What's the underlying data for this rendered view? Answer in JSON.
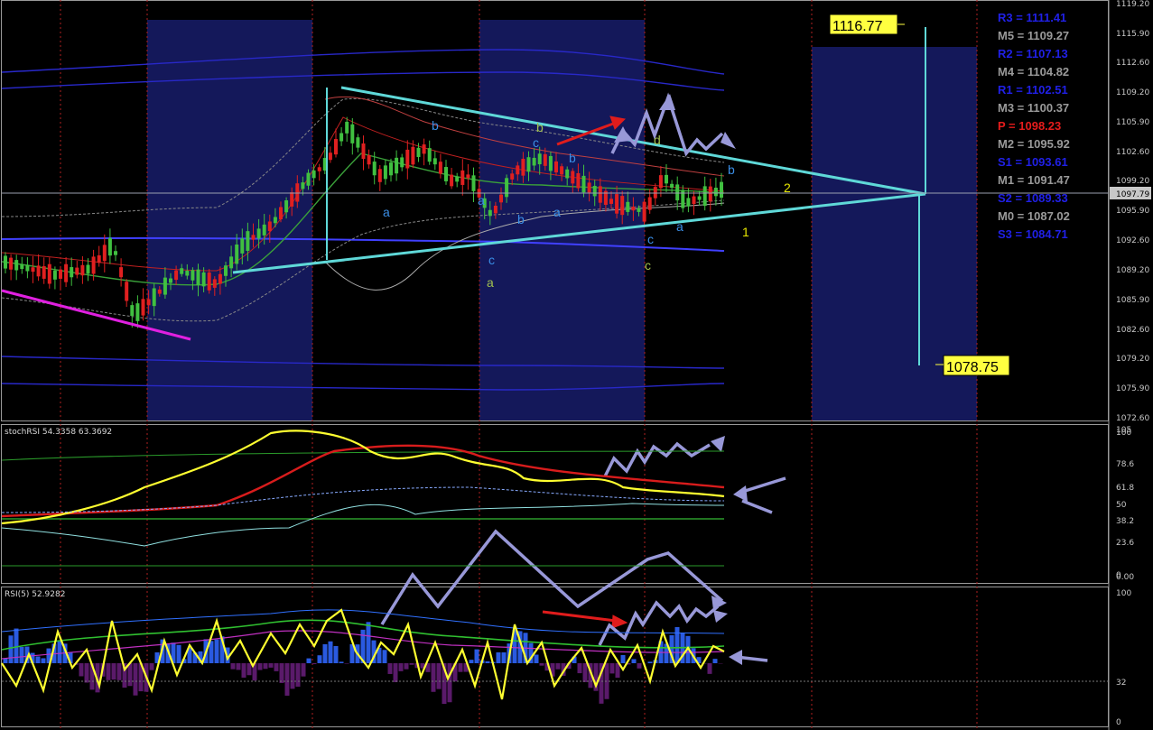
{
  "chart_data": [
    {
      "type": "candlestick",
      "panel": "price",
      "ylim": [
        1072.6,
        1119.2
      ],
      "y_ticks": [
        "1119.20",
        "1115.90",
        "1112.60",
        "1109.20",
        "1105.90",
        "1102.60",
        "1099.20",
        "1095.90",
        "1092.60",
        "1089.20",
        "1085.90",
        "1082.60",
        "1079.20",
        "1075.90",
        "1072.60"
      ],
      "current_price": "1097.79",
      "target_high": "1116.77",
      "target_low": "1078.75",
      "pivot_levels": [
        {
          "label": "R3 = 1111.41",
          "value": 1111.41,
          "color": "#2020e6"
        },
        {
          "label": "M5 = 1109.27",
          "value": 1109.27,
          "color": "#9a9a9a"
        },
        {
          "label": "R2 = 1107.13",
          "value": 1107.13,
          "color": "#2020e6"
        },
        {
          "label": "M4 = 1104.82",
          "value": 1104.82,
          "color": "#9a9a9a"
        },
        {
          "label": "R1 = 1102.51",
          "value": 1102.51,
          "color": "#2020e6"
        },
        {
          "label": "M3 = 1100.37",
          "value": 1100.37,
          "color": "#9a9a9a"
        },
        {
          "label": "P  = 1098.23",
          "value": 1098.23,
          "color": "#e61c1c"
        },
        {
          "label": "M2 = 1095.92",
          "value": 1095.92,
          "color": "#9a9a9a"
        },
        {
          "label": "S1 = 1093.61",
          "value": 1093.61,
          "color": "#2020e6"
        },
        {
          "label": "M1 = 1091.47",
          "value": 1091.47,
          "color": "#9a9a9a"
        },
        {
          "label": "S2 = 1089.33",
          "value": 1089.33,
          "color": "#2020e6"
        },
        {
          "label": "M0 = 1087.02",
          "value": 1087.02,
          "color": "#9a9a9a"
        },
        {
          "label": "S3 = 1084.71",
          "value": 1084.71,
          "color": "#2020e6"
        }
      ],
      "wave_labels": [
        {
          "text": "b",
          "color": "#a0c050"
        },
        {
          "text": "c",
          "color": "#3a8ee6"
        },
        {
          "text": "d",
          "color": "#a0c050"
        },
        {
          "text": "b",
          "color": "#3a8ee6"
        },
        {
          "text": "b",
          "color": "#3a8ee6"
        },
        {
          "text": "b",
          "color": "#3a8ee6"
        },
        {
          "text": "a",
          "color": "#3a8ee6"
        },
        {
          "text": "a",
          "color": "#3a8ee6"
        },
        {
          "text": "a",
          "color": "#3a8ee6"
        },
        {
          "text": "a",
          "color": "#3a8ee6"
        },
        {
          "text": "c",
          "color": "#3a8ee6"
        },
        {
          "text": "b",
          "color": "#3a8ee6"
        },
        {
          "text": "c",
          "color": "#3a8ee6"
        },
        {
          "text": "a",
          "color": "#a0c050"
        },
        {
          "text": "c",
          "color": "#a0c050"
        },
        {
          "text": "2",
          "color": "#e6e600"
        },
        {
          "text": "1",
          "color": "#e6e600"
        }
      ]
    },
    {
      "type": "line",
      "panel": "stochRSI",
      "title": "stochRSI 54.3358 63.3692",
      "y_ticks": [
        "105",
        "100",
        "78.6",
        "61.8",
        "50",
        "38.2",
        "23.6",
        "0",
        "0.00"
      ]
    },
    {
      "type": "line",
      "panel": "RSI",
      "title": "RSI(5) 52.9282",
      "y_ticks": [
        "100",
        "32",
        "0"
      ]
    }
  ]
}
